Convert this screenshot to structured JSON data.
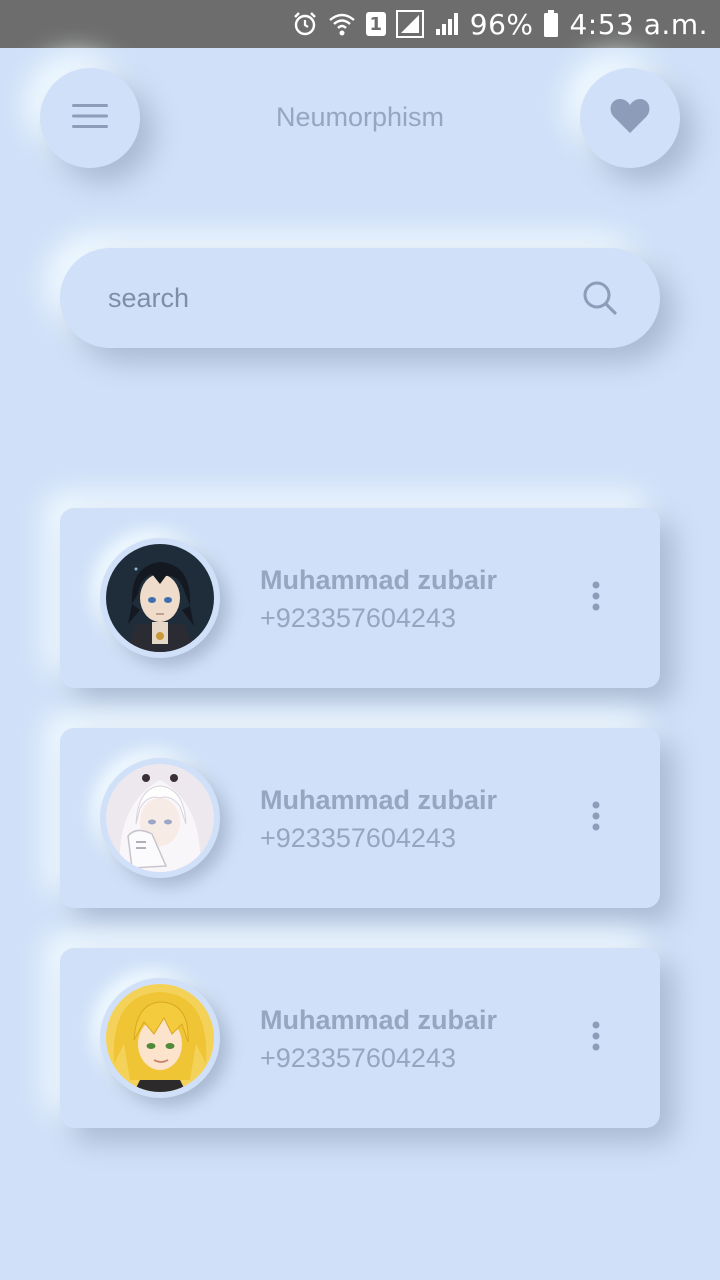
{
  "status_bar": {
    "icons": [
      "alarm-icon",
      "wifi-icon",
      "sim-1-icon",
      "signal-icon",
      "signal-icon",
      "battery-icon"
    ],
    "sim_label": "1",
    "battery": "96%",
    "time": "4:53 a.m."
  },
  "header": {
    "title": "Neumorphism",
    "menu_icon": "hamburger-menu-icon",
    "heart_icon": "heart-icon"
  },
  "search": {
    "placeholder": "search",
    "value": "",
    "icon": "search-icon"
  },
  "contacts": [
    {
      "name": "Muhammad zubair",
      "phone": "+923357604243",
      "avatar": "dark-haired-anime-character"
    },
    {
      "name": "Muhammad zubair",
      "phone": "+923357604243",
      "avatar": "white-haired-anime-character"
    },
    {
      "name": "Muhammad zubair",
      "phone": "+923357604243",
      "avatar": "blonde-anime-character"
    }
  ],
  "colors": {
    "background": "#d0e0f8",
    "text": "#96a5c0",
    "status_bar": "#6d6d6d",
    "icon": "#8d9cb8"
  }
}
